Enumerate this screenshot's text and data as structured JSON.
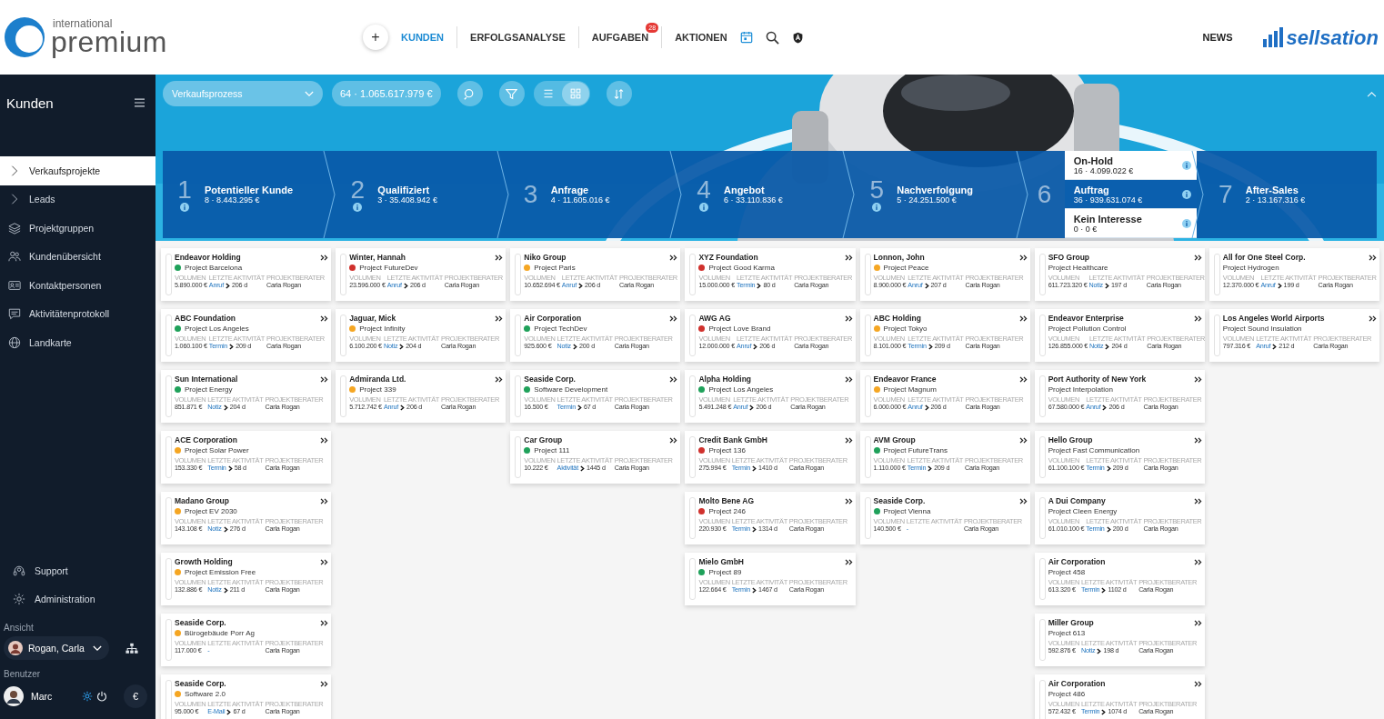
{
  "header": {
    "logo_small": "international",
    "logo_large": "premium",
    "add_button": "+",
    "nav": [
      {
        "label": "KUNDEN",
        "selected": true
      },
      {
        "label": "ERFOLGSANALYSE",
        "selected": false
      },
      {
        "label": "AUFGABEN",
        "selected": false,
        "badge": "28"
      },
      {
        "label": "AKTIONEN",
        "selected": false
      }
    ],
    "news": "NEWS",
    "brand": "sellsation"
  },
  "sidebar": {
    "title": "Kunden",
    "items": [
      {
        "label": "Verkaufsprojekte",
        "selected": true
      },
      {
        "label": "Leads",
        "selected": false
      },
      {
        "label": "Projektgruppen",
        "selected": false
      },
      {
        "label": "Kundenübersicht",
        "selected": false
      },
      {
        "label": "Kontaktpersonen",
        "selected": false
      },
      {
        "label": "Aktivitätenprotokoll",
        "selected": false
      },
      {
        "label": "Landkarte",
        "selected": false
      }
    ],
    "bottom_items": [
      "Support",
      "Administration"
    ],
    "view_label": "Ansicht",
    "view_user": "Rogan, Carla",
    "user_label": "Benutzer",
    "user": "Marc",
    "currency_button": "€"
  },
  "toolbar": {
    "process": "Verkaufsprozess",
    "summary": "64 · 1.065.617.979 €",
    "views": [
      {
        "kind": "list",
        "selected": false
      },
      {
        "kind": "grid",
        "selected": true
      }
    ]
  },
  "stages": [
    {
      "number": "1",
      "name": "Potentieller Kunde",
      "summary": "8 · 8.443.295 €",
      "info": true
    },
    {
      "number": "2",
      "name": "Qualifiziert",
      "summary": "3 · 35.408.942 €",
      "info": true
    },
    {
      "number": "3",
      "name": "Anfrage",
      "summary": "4 · 11.605.016 €",
      "info": false
    },
    {
      "number": "4",
      "name": "Angebot",
      "summary": "6 · 33.110.836 €",
      "info": true
    },
    {
      "number": "5",
      "name": "Nachverfolgung",
      "summary": "5 · 24.251.500 €",
      "info": true
    },
    {
      "number": "6",
      "substages": [
        {
          "name": "On-Hold",
          "summary": "16 · 4.099.022 €",
          "selected": false
        },
        {
          "name": "Auftrag",
          "summary": "36 · 939.631.074 €",
          "selected": true
        },
        {
          "name": "Kein Interesse",
          "summary": "0 · 0 €",
          "selected": false
        }
      ]
    },
    {
      "number": "7",
      "name": "After-Sales",
      "summary": "2 · 13.167.316 €",
      "info": false
    }
  ],
  "columns": [
    [
      {
        "company": "Endeavor Holding",
        "project": "Project Barcelona",
        "color": "#1fa15a",
        "labels": [
          "VOLUMEN",
          "LETZTE AKTIVITÄT",
          "PROJEKTBERATER"
        ],
        "volume": "5.890.000 €",
        "activity": "Anruf",
        "days": "206 d",
        "advisor": "Carla Rogan"
      },
      {
        "company": "ABC Foundation",
        "project": "Project Los Angeles",
        "color": "#1fa15a",
        "labels": [
          "VOLUMEN",
          "LETZTE AKTIVITÄT",
          "PROJEKTBERATER"
        ],
        "volume": "1.060.100 €",
        "activity": "Termin",
        "days": "209 d",
        "advisor": "Carla Rogan"
      },
      {
        "company": "Sun International",
        "project": "Project Energy",
        "color": "#1fa15a",
        "labels": [
          "VOLUMEN",
          "LETZTE AKTIVITÄT",
          "PROJEKTBERATER"
        ],
        "volume": "851.871 €",
        "activity": "Notiz",
        "days": "204 d",
        "advisor": "Carla Rogan"
      },
      {
        "company": "ACE Corporation",
        "project": "Project Solar Power",
        "color": "#f5a623",
        "labels": [
          "VOLUMEN",
          "LETZTE AKTIVITÄT",
          "PROJEKTBERATER"
        ],
        "volume": "153.330 €",
        "activity": "Termin",
        "days": "58 d",
        "advisor": "Carla Rogan"
      },
      {
        "company": "Madano Group",
        "project": "Project EV 2030",
        "color": "#f5a623",
        "labels": [
          "VOLUMEN",
          "LETZTE AKTIVITÄT",
          "PROJEKTBERATER"
        ],
        "volume": "143.108 €",
        "activity": "Notiz",
        "days": "276 d",
        "advisor": "Carla Rogan"
      },
      {
        "company": "Growth Holding",
        "project": "Project Emission Free",
        "color": "#f5a623",
        "labels": [
          "VOLUMEN",
          "LETZTE AKTIVITÄT",
          "PROJEKTBERATER"
        ],
        "volume": "132.886 €",
        "activity": "Notiz",
        "days": "211 d",
        "advisor": "Carla Rogan"
      },
      {
        "company": "Seaside Corp.",
        "project": "Bürogebäude Porr Ag",
        "color": "#f5a623",
        "labels": [
          "VOLUMEN",
          "LETZTE AKTIVITÄT",
          "PROJEKTBERATER"
        ],
        "volume": "117.000 €",
        "activity": "-",
        "advisor": "Carla Rogan"
      },
      {
        "company": "Seaside Corp.",
        "project": "Software 2.0",
        "color": "#f5a623",
        "labels": [
          "VOLUMEN",
          "LETZTE AKTIVITÄT",
          "PROJEKTBERATER"
        ],
        "volume": "95.000 €",
        "activity": "E-Mail",
        "days": "67 d",
        "advisor": "Carla Rogan"
      }
    ],
    [
      {
        "company": "Winter, Hannah",
        "project": "Project FutureDev",
        "color": "#d0312d",
        "labels": [
          "VOLUMEN",
          "LETZTE AKTIVITÄT",
          "PROJEKTBERATER"
        ],
        "volume": "23.596.000 €",
        "activity": "Anruf",
        "days": "206 d",
        "advisor": "Carla Rogan"
      },
      {
        "company": "Jaguar, Mick",
        "project": "Project Infinity",
        "color": "#f5a623",
        "labels": [
          "VOLUMEN",
          "LETZTE AKTIVITÄT",
          "PROJEKTBERATER"
        ],
        "volume": "6.100.200 €",
        "activity": "Notiz",
        "days": "204 d",
        "advisor": "Carla Rogan"
      },
      {
        "company": "Admiranda Ltd.",
        "project": "Project 339",
        "color": "#f5a623",
        "labels": [
          "VOLUMEN",
          "LETZTE AKTIVITÄT",
          "PROJEKTBERATER"
        ],
        "volume": "5.712.742 €",
        "activity": "Anruf",
        "days": "206 d",
        "advisor": "Carla Rogan"
      }
    ],
    [
      {
        "company": "Niko Group",
        "project": "Project Paris",
        "color": "#f5a623",
        "labels": [
          "VOLUMEN",
          "LETZTE AKTIVITÄT",
          "PROJEKTBERATER"
        ],
        "volume": "10.652.694 €",
        "activity": "Anruf",
        "days": "206 d",
        "advisor": "Carla Rogan"
      },
      {
        "company": "Air Corporation",
        "project": "Project TechDev",
        "color": "#1fa15a",
        "labels": [
          "VOLUMEN",
          "LETZTE AKTIVITÄT",
          "PROJEKTBERATER"
        ],
        "volume": "925.600 €",
        "activity": "Notiz",
        "days": "200 d",
        "advisor": "Carla Rogan"
      },
      {
        "company": "Seaside Corp.",
        "project": "Software Development",
        "color": "#1fa15a",
        "labels": [
          "VOLUMEN",
          "LETZTE AKTIVITÄT",
          "PROJEKTBERATER"
        ],
        "volume": "16.500 €",
        "activity": "Termin",
        "days": "67 d",
        "advisor": "Carla Rogan"
      },
      {
        "company": "Car Group",
        "project": "Project 111",
        "color": "#1fa15a",
        "labels": [
          "VOLUMEN",
          "LETZTE AKTIVITÄT",
          "PROJEKTBERATER"
        ],
        "volume": "10.222 €",
        "activity": "Aktivität",
        "days": "1445 d",
        "advisor": "Carla Rogan"
      }
    ],
    [
      {
        "company": "XYZ Foundation",
        "project": "Project Good Karma",
        "color": "#d0312d",
        "labels": [
          "VOLUMEN",
          "LETZTE AKTIVITÄT",
          "PROJEKTBERATER"
        ],
        "volume": "15.000.000 €",
        "activity": "Termin",
        "days": "80 d",
        "advisor": "Carla Rogan"
      },
      {
        "company": "AWG AG",
        "project": "Project Love Brand",
        "color": "#d0312d",
        "labels": [
          "VOLUMEN",
          "LETZTE AKTIVITÄT",
          "PROJEKTBERATER"
        ],
        "volume": "12.000.000 €",
        "activity": "Anruf",
        "days": "206 d",
        "advisor": "Carla Rogan"
      },
      {
        "company": "Alpha Holding",
        "project": "Project Los Angeles",
        "color": "#1fa15a",
        "labels": [
          "VOLUMEN",
          "LETZTE AKTIVITÄT",
          "PROJEKTBERATER"
        ],
        "volume": "5.491.248 €",
        "activity": "Anruf",
        "days": "206 d",
        "advisor": "Carla Rogan"
      },
      {
        "company": "Credit Bank GmbH",
        "project": "Project 136",
        "color": "#d0312d",
        "labels": [
          "VOLUMEN",
          "LETZTE AKTIVITÄT",
          "PROJEKTBERATER"
        ],
        "volume": "275.994 €",
        "activity": "Termin",
        "days": "1410 d",
        "advisor": "Carla Rogan"
      },
      {
        "company": "Molto Bene AG",
        "project": "Project 246",
        "color": "#d0312d",
        "labels": [
          "VOLUMEN",
          "LETZTE AKTIVITÄT",
          "PROJEKTBERATER"
        ],
        "volume": "220.930 €",
        "activity": "Termin",
        "days": "1314 d",
        "advisor": "Carla Rogan"
      },
      {
        "company": "Mielo GmbH",
        "project": "Project 89",
        "color": "#1fa15a",
        "labels": [
          "VOLUMEN",
          "LETZTE AKTIVITÄT",
          "PROJEKTBERATER"
        ],
        "volume": "122.664 €",
        "activity": "Termin",
        "days": "1467 d",
        "advisor": "Carla Rogan"
      }
    ],
    [
      {
        "company": "Lonnon, John",
        "project": "Project Peace",
        "color": "#f5a623",
        "labels": [
          "VOLUMEN",
          "LETZTE AKTIVITÄT",
          "PROJEKTBERATER"
        ],
        "volume": "8.900.000 €",
        "activity": "Anruf",
        "days": "207 d",
        "advisor": "Carla Rogan"
      },
      {
        "company": "ABC Holding",
        "project": "Project Tokyo",
        "color": "#f5a623",
        "labels": [
          "VOLUMEN",
          "LETZTE AKTIVITÄT",
          "PROJEKTBERATER"
        ],
        "volume": "8.101.000 €",
        "activity": "Termin",
        "days": "209 d",
        "advisor": "Carla Rogan"
      },
      {
        "company": "Endeavor France",
        "project": "Project Magnum",
        "color": "#f5a623",
        "labels": [
          "VOLUMEN",
          "LETZTE AKTIVITÄT",
          "PROJEKTBERATER"
        ],
        "volume": "6.000.000 €",
        "activity": "Anruf",
        "days": "206 d",
        "advisor": "Carla Rogan"
      },
      {
        "company": "AVM Group",
        "project": "Project FutureTrans",
        "color": "#1fa15a",
        "labels": [
          "VOLUMEN",
          "LETZTE AKTIVITÄT",
          "PROJEKTBERATER"
        ],
        "volume": "1.110.000 €",
        "activity": "Termin",
        "days": "209 d",
        "advisor": "Carla Rogan"
      },
      {
        "company": "Seaside Corp.",
        "project": "Project Vienna",
        "color": "#1fa15a",
        "labels": [
          "VOLUMEN",
          "LETZTE AKTIVITÄT",
          "PROJEKTBERATER"
        ],
        "volume": "140.500 €",
        "activity": "-",
        "advisor": "Carla Rogan"
      }
    ],
    [
      {
        "company": "SFO Group",
        "project": "Project Healthcare",
        "labels": [
          "VOLUMEN",
          "LETZTE AKTIVITÄT",
          "PROJEKTBERATER"
        ],
        "volume": "611.723.320 €",
        "activity": "Notiz",
        "days": "197 d",
        "advisor": "Carla Rogan"
      },
      {
        "company": "Endeavor Enterprise",
        "project": "Project Pollution Control",
        "labels": [
          "VOLUMEN",
          "LETZTE AKTIVITÄT",
          "PROJEKTBERATER"
        ],
        "volume": "126.855.000 €",
        "activity": "Notiz",
        "days": "204 d",
        "advisor": "Carla Rogan"
      },
      {
        "company": "Port Authority of New York",
        "project": "Project Interpolation",
        "labels": [
          "VOLUMEN",
          "LETZTE AKTIVITÄT",
          "PROJEKTBERATER"
        ],
        "volume": "67.580.000 €",
        "activity": "Anruf",
        "days": "206 d",
        "advisor": "Carla Rogan"
      },
      {
        "company": "Hello Group",
        "project": "Project Fast Communication",
        "labels": [
          "VOLUMEN",
          "LETZTE AKTIVITÄT",
          "PROJEKTBERATER"
        ],
        "volume": "61.100.100 €",
        "activity": "Termin",
        "days": "209 d",
        "advisor": "Carla Rogan"
      },
      {
        "company": "A Dui Company",
        "project": "Project Cleen Energy",
        "labels": [
          "VOLUMEN",
          "LETZTE AKTIVITÄT",
          "PROJEKTBERATER"
        ],
        "volume": "61.010.100 €",
        "activity": "Termin",
        "days": "200 d",
        "advisor": "Carla Rogan"
      },
      {
        "company": "Air Corporation",
        "project": "Project 458",
        "labels": [
          "VOLUMEN",
          "LETZTE AKTIVITÄT",
          "PROJEKTBERATER"
        ],
        "volume": "613.320 €",
        "activity": "Termin",
        "days": "1102 d",
        "advisor": "Carla Rogan"
      },
      {
        "company": "Miller Group",
        "project": "Project 613",
        "labels": [
          "VOLUMEN",
          "LETZTE AKTIVITÄT",
          "PROJEKTBERATER"
        ],
        "volume": "592.876 €",
        "activity": "Notiz",
        "days": "198 d",
        "advisor": "Carla Rogan"
      },
      {
        "company": "Air Corporation",
        "project": "Project 486",
        "labels": [
          "VOLUMEN",
          "LETZTE AKTIVITÄT",
          "PROJEKTBERATER"
        ],
        "volume": "572.432 €",
        "activity": "Termin",
        "days": "1074 d",
        "advisor": "Carla Rogan"
      }
    ],
    [
      {
        "company": "All for One Steel Corp.",
        "project": "Project Hydrogen",
        "labels": [
          "VOLUMEN",
          "LETZTE AKTIVITÄT",
          "PROJEKTBERATER"
        ],
        "volume": "12.370.000 €",
        "activity": "Anruf",
        "days": "199 d",
        "advisor": "Carla Rogan"
      },
      {
        "company": "Los Angeles World Airports",
        "project": "Project Sound Insulation",
        "labels": [
          "VOLUMEN",
          "LETZTE AKTIVITÄT",
          "PROJEKTBERATER"
        ],
        "volume": "797.316 €",
        "activity": "Anruf",
        "days": "212 d",
        "advisor": "Carla Rogan"
      }
    ]
  ]
}
